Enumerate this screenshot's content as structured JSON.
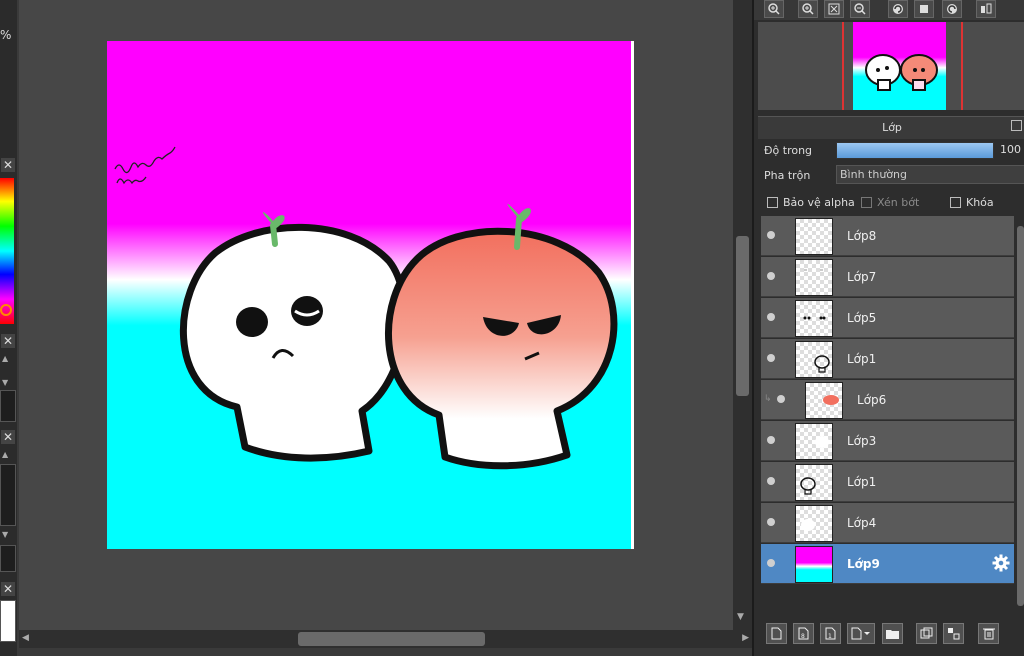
{
  "left_strip": {
    "percent_label": "%",
    "close_glyph": "✕"
  },
  "navigator": {
    "toolbar_icons": [
      "zoom-in-icon",
      "zoom-in-icon",
      "fit-screen-icon",
      "zoom-out-icon",
      "rotate-left-icon",
      "fullscreen-icon",
      "rotate-right-icon",
      "flip-icon"
    ]
  },
  "layer_panel": {
    "title": "Lớp",
    "opacity_label": "Độ trong",
    "opacity_value": "100 %",
    "opacity_fraction": 1.0,
    "blend_label": "Pha trộn",
    "blend_value": "Bình thường",
    "protect_alpha": "Bảo vệ alpha",
    "clipping": "Xén bớt",
    "lock": "Khóa",
    "layers": [
      {
        "name": "Lớp8"
      },
      {
        "name": "Lớp7"
      },
      {
        "name": "Lớp5"
      },
      {
        "name": "Lớp1"
      },
      {
        "name": "Lớp6"
      },
      {
        "name": "Lớp3"
      },
      {
        "name": "Lớp1"
      },
      {
        "name": "Lớp4"
      },
      {
        "name": "Lớp9"
      }
    ],
    "selected_layer": "Lớp9"
  },
  "colors": {
    "canvas_top": "#ff00ff",
    "canvas_bottom": "#00ffff",
    "selected_row": "#4f88c4",
    "peach": "#f58a78"
  }
}
